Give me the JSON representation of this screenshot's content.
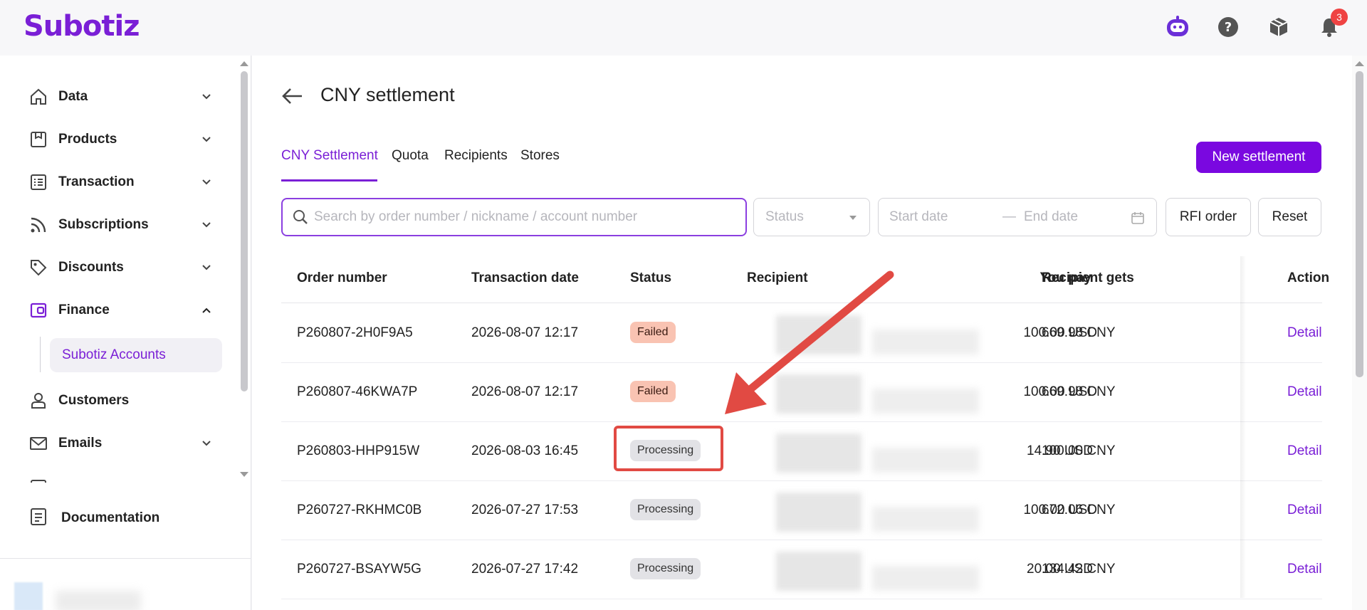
{
  "app": {
    "logo": "Subotiz",
    "notification_count": "3"
  },
  "sidebar": {
    "items": [
      {
        "label": "Data",
        "icon": "home-icon"
      },
      {
        "label": "Products",
        "icon": "product-box-icon"
      },
      {
        "label": "Transaction",
        "icon": "list-icon"
      },
      {
        "label": "Subscriptions",
        "icon": "rss-icon"
      },
      {
        "label": "Discounts",
        "icon": "tag-icon"
      },
      {
        "label": "Finance",
        "icon": "wallet-icon"
      },
      {
        "label": "Customers",
        "icon": "user-icon"
      },
      {
        "label": "Emails",
        "icon": "mail-icon"
      }
    ],
    "finance_sub": "Subotiz Accounts",
    "documentation": "Documentation"
  },
  "page": {
    "title": "CNY settlement",
    "tabs": [
      "CNY Settlement",
      "Quota",
      "Recipients",
      "Stores"
    ],
    "new_button": "New settlement"
  },
  "filters": {
    "search_placeholder": "Search by order number / nickname / account number",
    "status_placeholder": "Status",
    "start_date_placeholder": "Start date",
    "date_separator": "—",
    "end_date_placeholder": "End date",
    "rfi_button": "RFI order",
    "reset_button": "Reset"
  },
  "table": {
    "headers": [
      "Order number",
      "Transaction date",
      "Status",
      "Recipient",
      "You pay",
      "Recipient gets",
      "Action"
    ],
    "rows": [
      {
        "order": "P260807-2H0F9A5",
        "date": "2026-08-07 12:17",
        "status": "Failed",
        "pay": "100.00 USD",
        "gets": "669.98 CNY",
        "action": "Detail"
      },
      {
        "order": "P260807-46KWA7P",
        "date": "2026-08-07 12:17",
        "status": "Failed",
        "pay": "100.00 USD",
        "gets": "669.98 CNY",
        "action": "Detail"
      },
      {
        "order": "P260803-HHP915W",
        "date": "2026-08-03 16:45",
        "status": "Processing",
        "pay": "14.90 USD",
        "gets": "100.00 CNY",
        "action": "Detail"
      },
      {
        "order": "P260727-RKHMC0B",
        "date": "2026-07-27 17:53",
        "status": "Processing",
        "pay": "100.00 USD",
        "gets": "672.06 CNY",
        "action": "Detail"
      },
      {
        "order": "P260727-BSAYW5G",
        "date": "2026-07-27 17:42",
        "status": "Processing",
        "pay": "20.00 USD",
        "gets": "134.42 CNY",
        "action": "Detail"
      }
    ]
  },
  "colors": {
    "brand": "#7a1fd6",
    "failed_bg": "#f9c3b2",
    "processing_bg": "#e2e2e6",
    "annotation": "#e14a43"
  }
}
